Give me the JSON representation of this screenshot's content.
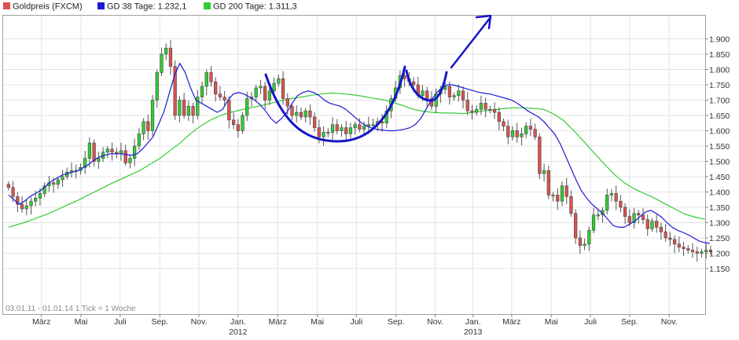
{
  "chart_data": {
    "type": "candlestick",
    "legend": [
      {
        "label": "Goldpreis (FXCM)",
        "color": "#d9534f"
      },
      {
        "label": "GD 38 Tage: 1.232,1",
        "color": "#1a1ad6"
      },
      {
        "label": "GD 200 Tage: 1.311,3",
        "color": "#33cc33"
      }
    ],
    "footer": "03.01.11 - 01.01.14   1 Tick = 1 Woche",
    "y_ticks": [
      "1.900",
      "1.850",
      "1.800",
      "1.750",
      "1.700",
      "1.650",
      "1.600",
      "1.550",
      "1.500",
      "1.450",
      "1.400",
      "1.350",
      "1.300",
      "1.250",
      "1.200",
      "1.150"
    ],
    "y_tick_values": [
      1900,
      1850,
      1800,
      1750,
      1700,
      1650,
      1600,
      1550,
      1500,
      1450,
      1400,
      1350,
      1300,
      1250,
      1200,
      1150
    ],
    "ylim": [
      1125,
      1935
    ],
    "x_range_weeks": [
      0,
      156
    ],
    "x_ticks": [
      {
        "label": "März",
        "week": 8.5
      },
      {
        "label": "Mai",
        "week": 17.3
      },
      {
        "label": "Juli",
        "week": 26
      },
      {
        "label": "Sep.",
        "week": 34.8
      },
      {
        "label": "Nov.",
        "week": 43.5
      },
      {
        "label": "Jan.",
        "week": 52.2,
        "year": "2012"
      },
      {
        "label": "März",
        "week": 61
      },
      {
        "label": "Mai",
        "week": 69.8
      },
      {
        "label": "Juli",
        "week": 78.5
      },
      {
        "label": "Sep.",
        "week": 87.3
      },
      {
        "label": "Nov.",
        "week": 96
      },
      {
        "label": "Jan.",
        "week": 104.4,
        "year": "2013"
      },
      {
        "label": "März",
        "week": 113
      },
      {
        "label": "Mai",
        "week": 121.8
      },
      {
        "label": "Juli",
        "week": 130.5
      },
      {
        "label": "Sep.",
        "week": 139.2
      },
      {
        "label": "Nov.",
        "week": 148
      }
    ],
    "grid": true,
    "close_series": [
      1415,
      1385,
      1360,
      1345,
      1355,
      1370,
      1380,
      1395,
      1420,
      1430,
      1425,
      1440,
      1450,
      1465,
      1470,
      1470,
      1480,
      1510,
      1560,
      1500,
      1510,
      1530,
      1540,
      1530,
      1525,
      1535,
      1495,
      1510,
      1550,
      1590,
      1630,
      1600,
      1700,
      1790,
      1850,
      1870,
      1810,
      1650,
      1700,
      1650,
      1680,
      1650,
      1710,
      1745,
      1790,
      1760,
      1720,
      1710,
      1700,
      1635,
      1620,
      1600,
      1650,
      1705,
      1710,
      1740,
      1745,
      1700,
      1730,
      1755,
      1770,
      1705,
      1680,
      1650,
      1660,
      1645,
      1665,
      1645,
      1610,
      1580,
      1595,
      1595,
      1620,
      1600,
      1610,
      1590,
      1610,
      1620,
      1605,
      1615,
      1620,
      1620,
      1630,
      1625,
      1665,
      1705,
      1740,
      1780,
      1770,
      1760,
      1750,
      1715,
      1730,
      1705,
      1680,
      1720,
      1735,
      1745,
      1710,
      1715,
      1730,
      1700,
      1665,
      1660,
      1670,
      1690,
      1670,
      1670,
      1660,
      1630,
      1615,
      1580,
      1600,
      1580,
      1590,
      1615,
      1605,
      1580,
      1460,
      1470,
      1390,
      1390,
      1370,
      1420,
      1385,
      1330,
      1250,
      1225,
      1230,
      1275,
      1325,
      1325,
      1340,
      1390,
      1395,
      1370,
      1350,
      1320,
      1300,
      1330,
      1325,
      1310,
      1280,
      1305,
      1285,
      1270,
      1250,
      1245,
      1230,
      1220,
      1215,
      1210,
      1205,
      1200,
      1205,
      1210,
      1205
    ],
    "gd38_series": [
      1390,
      1375,
      1360,
      1370,
      1385,
      1395,
      1405,
      1420,
      1435,
      1445,
      1455,
      1460,
      1465,
      1470,
      1480,
      1490,
      1505,
      1515,
      1520,
      1525,
      1525,
      1525,
      1522,
      1520,
      1525,
      1540,
      1560,
      1580,
      1620,
      1660,
      1720,
      1780,
      1820,
      1790,
      1740,
      1700,
      1690,
      1680,
      1670,
      1660,
      1670,
      1700,
      1720,
      1725,
      1720,
      1710,
      1700,
      1685,
      1665,
      1640,
      1625,
      1640,
      1660,
      1690,
      1715,
      1725,
      1730,
      1725,
      1715,
      1700,
      1690,
      1685,
      1680,
      1670,
      1655,
      1640,
      1625,
      1615,
      1608,
      1604,
      1602,
      1600,
      1600,
      1602,
      1605,
      1610,
      1620,
      1640,
      1670,
      1700,
      1725,
      1740,
      1750,
      1750,
      1745,
      1740,
      1735,
      1730,
      1725,
      1722,
      1720,
      1715,
      1710,
      1705,
      1700,
      1690,
      1678,
      1665,
      1655,
      1645,
      1630,
      1610,
      1590,
      1560,
      1520,
      1480,
      1440,
      1405,
      1380,
      1360,
      1345,
      1330,
      1310,
      1290,
      1285,
      1285,
      1295,
      1305,
      1320,
      1335,
      1340,
      1330,
      1318,
      1300,
      1285,
      1275,
      1268,
      1260,
      1250,
      1240,
      1235,
      1232
    ],
    "gd200_series": [
      1285,
      1295,
      1305,
      1318,
      1330,
      1345,
      1360,
      1375,
      1392,
      1408,
      1425,
      1440,
      1455,
      1470,
      1490,
      1510,
      1535,
      1560,
      1590,
      1615,
      1635,
      1650,
      1660,
      1668,
      1675,
      1682,
      1690,
      1698,
      1705,
      1710,
      1716,
      1720,
      1723,
      1721,
      1718,
      1713,
      1707,
      1702,
      1693,
      1683,
      1671,
      1664,
      1660,
      1658,
      1658,
      1656,
      1660,
      1665,
      1668,
      1672,
      1675,
      1675,
      1673,
      1670,
      1655,
      1633,
      1600,
      1565,
      1528,
      1492,
      1458,
      1430,
      1410,
      1395,
      1380,
      1362,
      1345,
      1328,
      1318,
      1311
    ]
  }
}
